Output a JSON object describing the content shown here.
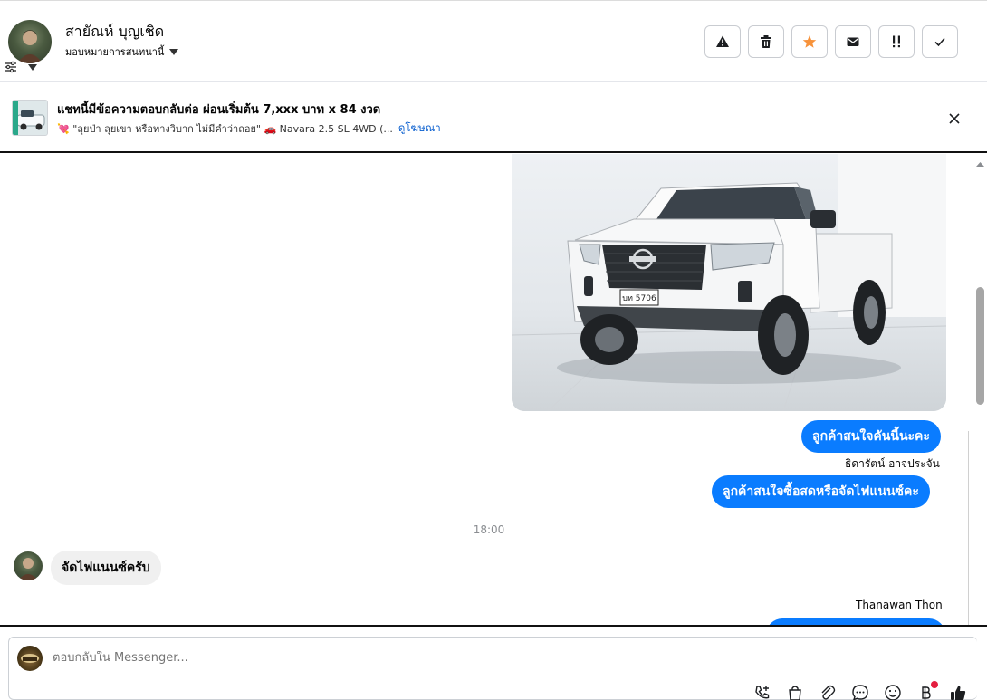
{
  "header": {
    "contact_name": "สายัณห์ บุญเชิด",
    "assign_label": "มอบหมายการสนทนานี้",
    "actions": [
      {
        "name": "report-spam-button",
        "icon": "warning-icon"
      },
      {
        "name": "delete-button",
        "icon": "trash-icon"
      },
      {
        "name": "star-button",
        "icon": "star-icon",
        "color": "#f7923a"
      },
      {
        "name": "mark-unread-button",
        "icon": "envelope-icon"
      },
      {
        "name": "follow-up-button",
        "icon": "exclamation-icon"
      },
      {
        "name": "mark-done-button",
        "icon": "check-icon"
      }
    ]
  },
  "ad": {
    "title": "แชทนี้มีข้อความตอบกลับต่อ ผ่อนเริ่มต้น 7,xxx บาท x 84 งวด",
    "subtitle": "💘 \"ลุยป่า ลุยเขา หรือทางวิบาก ไม่มีคำว่าถอย\" 🚗 Navara 2.5 SL 4WD (...",
    "link_label": "ดูโฆษณา"
  },
  "conversation": {
    "outgoing_1": "ลูกค้าสนใจคันนี้นะคะ",
    "sender_1": "ธิดารัตน์ อาจประจัน",
    "outgoing_2": "ลูกค้าสนใจซื้อสดหรือจัดไฟแนนซ์คะ",
    "timestamp": "18:00",
    "incoming_1": "จัดไฟแนนซ์ครับ",
    "sender_2": "Thanawan Thon",
    "car_plate": "บท 5706"
  },
  "composer": {
    "placeholder": "ตอบกลับใน Messenger...",
    "tools": [
      "add-call-icon",
      "shopping-bag-icon",
      "paperclip-icon",
      "chat-bubble-icon",
      "emoji-icon",
      "baht-icon",
      "thumbs-up-icon"
    ]
  },
  "colors": {
    "messenger_blue": "#0a7cff",
    "link_blue": "#0a5fcf",
    "star_orange": "#f7923a"
  }
}
